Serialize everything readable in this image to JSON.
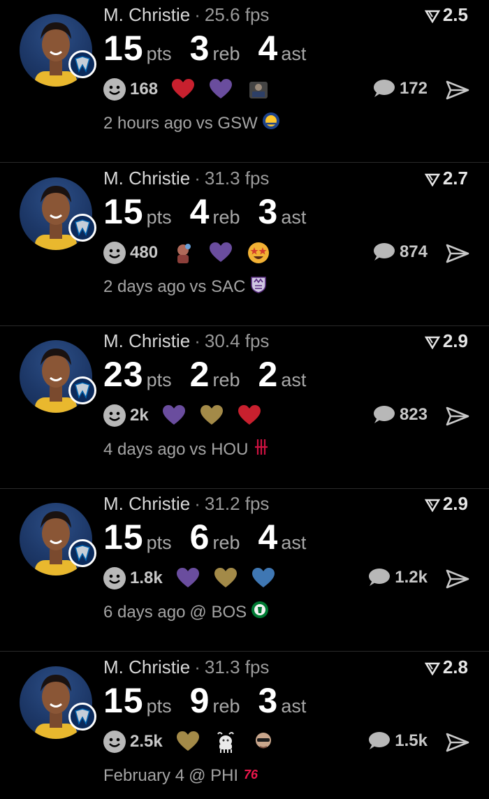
{
  "feed": [
    {
      "player": "M. Christie",
      "fps": "25.6 fps",
      "rating": "2.5",
      "stats": [
        {
          "value": "15",
          "unit": "pts"
        },
        {
          "value": "3",
          "unit": "reb"
        },
        {
          "value": "4",
          "unit": "ast"
        }
      ],
      "reaction_count": "168",
      "reaction_icons": [
        "red-heart-icon",
        "purple-heart-icon",
        "photo-sticker-icon"
      ],
      "comments": "172",
      "time": "2 hours ago",
      "opponent": "vs GSW",
      "team_badge": "mavericks-logo-icon",
      "opponent_logo": "warriors-logo-icon"
    },
    {
      "player": "M. Christie",
      "fps": "31.3 fps",
      "rating": "2.7",
      "stats": [
        {
          "value": "15",
          "unit": "pts"
        },
        {
          "value": "4",
          "unit": "reb"
        },
        {
          "value": "3",
          "unit": "ast"
        }
      ],
      "reaction_count": "480",
      "reaction_icons": [
        "photo-sticker-icon",
        "purple-heart-icon",
        "star-eyes-emoji-icon"
      ],
      "comments": "874",
      "time": "2 days ago",
      "opponent": "vs SAC",
      "team_badge": "mavericks-logo-icon",
      "opponent_logo": "kings-logo-icon"
    },
    {
      "player": "M. Christie",
      "fps": "30.4 fps",
      "rating": "2.9",
      "stats": [
        {
          "value": "23",
          "unit": "pts"
        },
        {
          "value": "2",
          "unit": "reb"
        },
        {
          "value": "2",
          "unit": "ast"
        }
      ],
      "reaction_count": "2k",
      "reaction_icons": [
        "purple-heart-icon",
        "gold-heart-icon",
        "red-heart-icon"
      ],
      "comments": "823",
      "time": "4 days ago",
      "opponent": "vs HOU",
      "team_badge": "mavericks-logo-icon",
      "opponent_logo": "rockets-logo-icon"
    },
    {
      "player": "M. Christie",
      "fps": "31.2 fps",
      "rating": "2.9",
      "stats": [
        {
          "value": "15",
          "unit": "pts"
        },
        {
          "value": "6",
          "unit": "reb"
        },
        {
          "value": "4",
          "unit": "ast"
        }
      ],
      "reaction_count": "1.8k",
      "reaction_icons": [
        "purple-heart-icon",
        "gold-heart-icon",
        "blue-heart-icon"
      ],
      "comments": "1.2k",
      "time": "6 days ago",
      "opponent": "@ BOS",
      "team_badge": "mavericks-logo-icon",
      "opponent_logo": "celtics-logo-icon"
    },
    {
      "player": "M. Christie",
      "fps": "31.3 fps",
      "rating": "2.8",
      "stats": [
        {
          "value": "15",
          "unit": "pts"
        },
        {
          "value": "9",
          "unit": "reb"
        },
        {
          "value": "3",
          "unit": "ast"
        }
      ],
      "reaction_count": "2.5k",
      "reaction_icons": [
        "gold-heart-icon",
        "goat-icon",
        "photo-sticker-icon"
      ],
      "comments": "1.5k",
      "time": "February 4",
      "opponent": "@ PHI",
      "team_badge": "mavericks-logo-icon",
      "opponent_logo": "76ers-logo-icon"
    }
  ],
  "colors": {
    "background": "#000000",
    "divider": "#2a2a2a",
    "red_heart": "#c8202e",
    "purple_heart": "#6a4d9e",
    "gold_heart": "#a38a48",
    "blue_heart": "#3f77b3",
    "avatar_bg": "#1d3868"
  }
}
